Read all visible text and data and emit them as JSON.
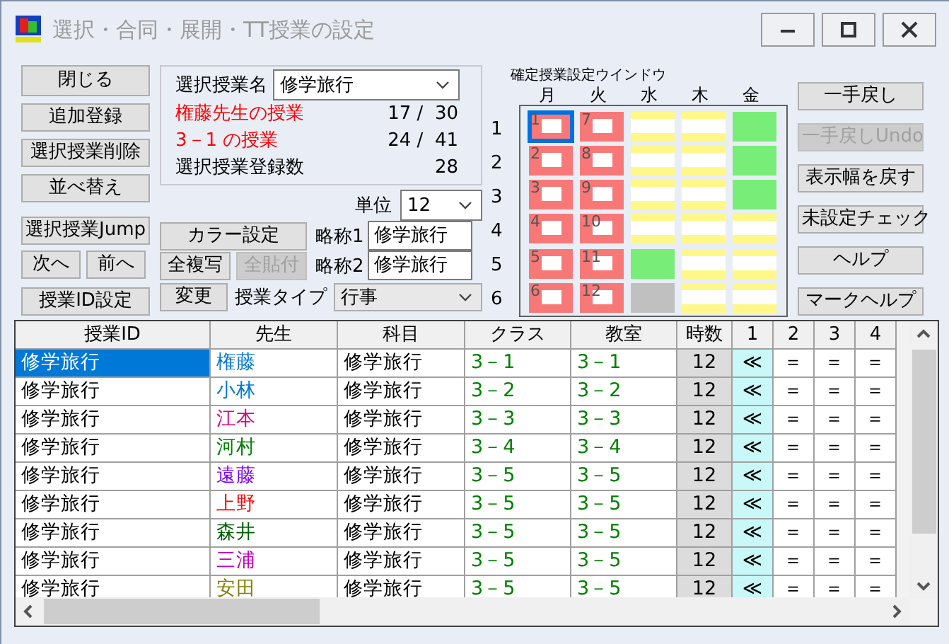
{
  "window": {
    "title": "選択・合同・展開・TT授業の設定"
  },
  "left_buttons": [
    {
      "label": "閉じる"
    },
    {
      "label": "追加登録"
    },
    {
      "label": "選択授業削除"
    },
    {
      "label": "並べ替え"
    },
    {
      "label": "選択授業Jump"
    },
    {
      "label": "次へ"
    },
    {
      "label": "前へ"
    },
    {
      "label": "授業ID設定"
    }
  ],
  "selection": {
    "label": "選択授業名",
    "value": "修学旅行",
    "stats": [
      {
        "label": "権藤先生の授業",
        "value": "17 /  30",
        "alert": true
      },
      {
        "label": "3－1 の授業",
        "value": "24 /  41",
        "alert": true
      },
      {
        "label": "選択授業登録数",
        "value": "28",
        "alert": false
      }
    ]
  },
  "unit": {
    "label": "単位",
    "value": "12"
  },
  "color_button": {
    "label": "カラー設定"
  },
  "copy_buttons": [
    {
      "label": "全複写",
      "disabled": false
    },
    {
      "label": "全貼付",
      "disabled": true
    }
  ],
  "change_button": {
    "label": "変更"
  },
  "short_names": [
    {
      "label": "略称1",
      "value": "修学旅行"
    },
    {
      "label": "略称2",
      "value": "修学旅行"
    }
  ],
  "lesson_type": {
    "label": "授業タイプ",
    "value": "行事"
  },
  "timetable": {
    "title": "確定授業設定ウインドウ",
    "days": [
      "月",
      "火",
      "水",
      "木",
      "金"
    ],
    "periods": [
      "1",
      "2",
      "3",
      "4",
      "5",
      "6"
    ],
    "rows": [
      [
        {
          "kind": "lesson",
          "label": "1",
          "selected": true
        },
        {
          "kind": "lesson",
          "label": "7",
          "selected": false
        },
        {
          "kind": "free",
          "selected": false
        },
        {
          "kind": "free",
          "selected": false
        },
        {
          "kind": "fixed",
          "selected": false
        }
      ],
      [
        {
          "kind": "lesson",
          "label": "2",
          "selected": false
        },
        {
          "kind": "lesson",
          "label": "8",
          "selected": false
        },
        {
          "kind": "free",
          "selected": false
        },
        {
          "kind": "free",
          "selected": false
        },
        {
          "kind": "fixed",
          "selected": false
        }
      ],
      [
        {
          "kind": "lesson",
          "label": "3",
          "selected": false
        },
        {
          "kind": "lesson",
          "label": "9",
          "selected": false
        },
        {
          "kind": "free",
          "selected": false
        },
        {
          "kind": "free",
          "selected": false
        },
        {
          "kind": "fixed",
          "selected": false
        }
      ],
      [
        {
          "kind": "lesson",
          "label": "4",
          "selected": false
        },
        {
          "kind": "lesson",
          "label": "10",
          "selected": false
        },
        {
          "kind": "free",
          "selected": false
        },
        {
          "kind": "free",
          "selected": false
        },
        {
          "kind": "free",
          "selected": false
        }
      ],
      [
        {
          "kind": "lesson",
          "label": "5",
          "selected": false
        },
        {
          "kind": "lesson",
          "label": "11",
          "selected": false
        },
        {
          "kind": "fixed",
          "selected": false
        },
        {
          "kind": "free",
          "selected": false
        },
        {
          "kind": "free",
          "selected": false
        }
      ],
      [
        {
          "kind": "lesson",
          "label": "6",
          "selected": false
        },
        {
          "kind": "lesson",
          "label": "12",
          "selected": false
        },
        {
          "kind": "blocked",
          "selected": false
        },
        {
          "kind": "free",
          "selected": false
        },
        {
          "kind": "free",
          "selected": false
        }
      ]
    ]
  },
  "right_buttons": [
    {
      "label": "一手戻し",
      "disabled": false
    },
    {
      "label": "一手戻しUndo",
      "disabled": true
    },
    {
      "label": "表示幅を戻す",
      "disabled": false
    },
    {
      "label": "未設定チェック",
      "disabled": false
    },
    {
      "label": "ヘルプ",
      "disabled": false
    },
    {
      "label": "マークヘルプ",
      "disabled": false
    }
  ],
  "table": {
    "columns": [
      "授業ID",
      "先生",
      "科目",
      "クラス",
      "教室",
      "時数",
      "1",
      "2",
      "3",
      "4"
    ],
    "rows": [
      {
        "id": "修学旅行",
        "teacher": "権藤",
        "color": "#0078d7",
        "subject": "修学旅行",
        "class": "3－1",
        "room": "3－1",
        "hours": "12",
        "marks": [
          "≪",
          "＝",
          "＝",
          "＝"
        ],
        "selected": true
      },
      {
        "id": "修学旅行",
        "teacher": "小林",
        "color": "#0078d7",
        "subject": "修学旅行",
        "class": "3－2",
        "room": "3－2",
        "hours": "12",
        "marks": [
          "≪",
          "＝",
          "＝",
          "＝"
        ],
        "selected": false
      },
      {
        "id": "修学旅行",
        "teacher": "江本",
        "color": "#e0007f",
        "subject": "修学旅行",
        "class": "3－3",
        "room": "3－3",
        "hours": "12",
        "marks": [
          "≪",
          "＝",
          "＝",
          "＝"
        ],
        "selected": false
      },
      {
        "id": "修学旅行",
        "teacher": "河村",
        "color": "#008000",
        "subject": "修学旅行",
        "class": "3－4",
        "room": "3－4",
        "hours": "12",
        "marks": [
          "≪",
          "＝",
          "＝",
          "＝"
        ],
        "selected": false
      },
      {
        "id": "修学旅行",
        "teacher": "遠藤",
        "color": "#8000ff",
        "subject": "修学旅行",
        "class": "3－5",
        "room": "3－5",
        "hours": "12",
        "marks": [
          "≪",
          "＝",
          "＝",
          "＝"
        ],
        "selected": false
      },
      {
        "id": "修学旅行",
        "teacher": "上野",
        "color": "#ff0000",
        "subject": "修学旅行",
        "class": "3－5",
        "room": "3－5",
        "hours": "12",
        "marks": [
          "≪",
          "＝",
          "＝",
          "＝"
        ],
        "selected": false
      },
      {
        "id": "修学旅行",
        "teacher": "森井",
        "color": "#006000",
        "subject": "修学旅行",
        "class": "3－5",
        "room": "3－5",
        "hours": "12",
        "marks": [
          "≪",
          "＝",
          "＝",
          "＝"
        ],
        "selected": false
      },
      {
        "id": "修学旅行",
        "teacher": "三浦",
        "color": "#c000c0",
        "subject": "修学旅行",
        "class": "3－5",
        "room": "3－5",
        "hours": "12",
        "marks": [
          "≪",
          "＝",
          "＝",
          "＝"
        ],
        "selected": false
      },
      {
        "id": "修学旅行",
        "teacher": "安田",
        "color": "#808000",
        "subject": "修学旅行",
        "class": "3－5",
        "room": "3－5",
        "hours": "12",
        "marks": [
          "≪",
          "＝",
          "＝",
          "＝"
        ],
        "selected": false
      }
    ]
  }
}
